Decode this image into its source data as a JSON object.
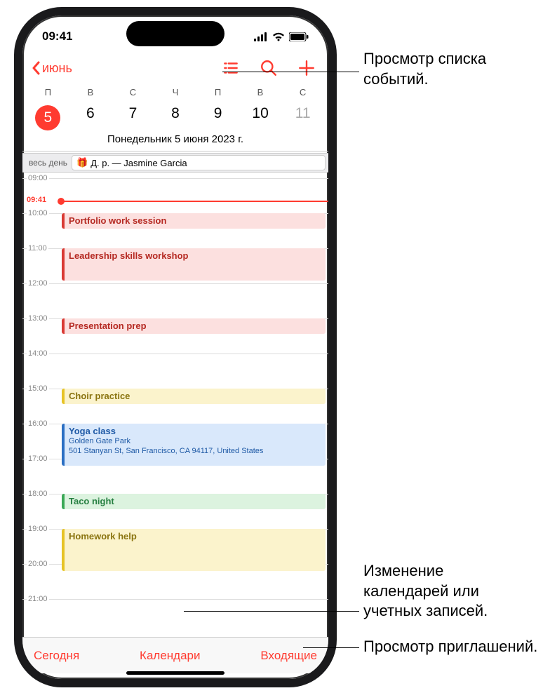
{
  "status": {
    "time": "09:41"
  },
  "nav": {
    "back": "июнь"
  },
  "weekdays": [
    "П",
    "В",
    "С",
    "Ч",
    "П",
    "В",
    "С"
  ],
  "dates": [
    "5",
    "6",
    "7",
    "8",
    "9",
    "10",
    "11"
  ],
  "fullDate": "Понедельник  5 июня 2023 г.",
  "allday": {
    "label": "весь день",
    "event": "Д. р. — Jasmine Garcia"
  },
  "hours": [
    "09:00",
    "10:00",
    "11:00",
    "12:00",
    "13:00",
    "14:00",
    "15:00",
    "16:00",
    "17:00",
    "18:00",
    "19:00",
    "20:00",
    "21:00"
  ],
  "nowTime": "09:41",
  "events": {
    "e1": {
      "title": "Portfolio work session"
    },
    "e2": {
      "title": "Leadership skills workshop"
    },
    "e3": {
      "title": "Presentation prep"
    },
    "e4": {
      "title": "Choir practice"
    },
    "e5": {
      "title": "Yoga class",
      "loc1": "Golden Gate Park",
      "loc2": "501 Stanyan St, San Francisco, CA 94117, United States"
    },
    "e6": {
      "title": "Taco night"
    },
    "e7": {
      "title": "Homework help"
    }
  },
  "bottom": {
    "today": "Сегодня",
    "calendars": "Календари",
    "inbox": "Входящие"
  },
  "callouts": {
    "c1": "Просмотр списка событий.",
    "c2": "Изменение календарей или учетных записей.",
    "c3": "Просмотр приглашений."
  }
}
